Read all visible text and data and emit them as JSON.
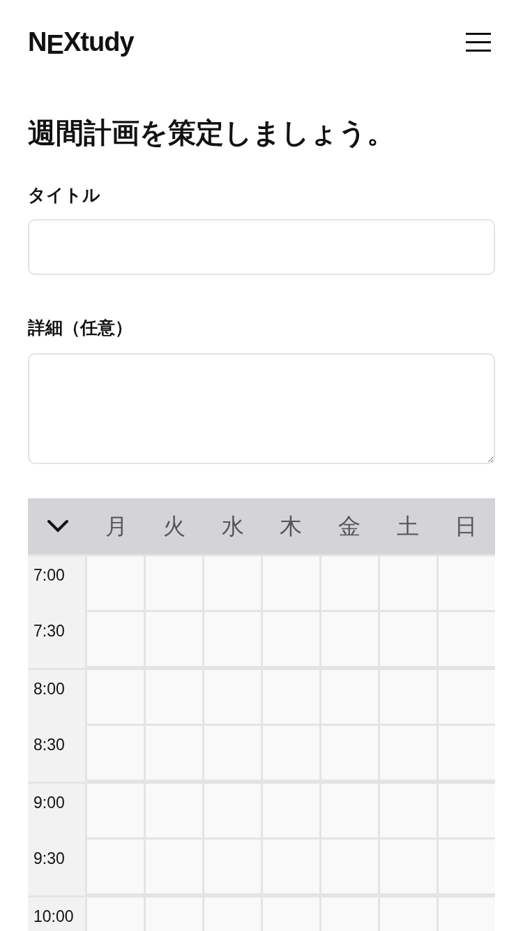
{
  "header": {
    "logo": "N$_{E}$Xtudy"
  },
  "heading": "週間計画を策定しましょう。",
  "form": {
    "title_label": "タイトル",
    "detail_label": "詳細（任意）"
  },
  "schedule": {
    "toggle_expanded": true,
    "days": [
      "月",
      "火",
      "水",
      "木",
      "金",
      "土",
      "日"
    ],
    "hours": [
      {
        "slots": [
          "7:00",
          "7:30"
        ]
      },
      {
        "slots": [
          "8:00",
          "8:30"
        ]
      },
      {
        "slots": [
          "9:00",
          "9:30"
        ]
      },
      {
        "slots": [
          "10:00"
        ]
      }
    ]
  }
}
